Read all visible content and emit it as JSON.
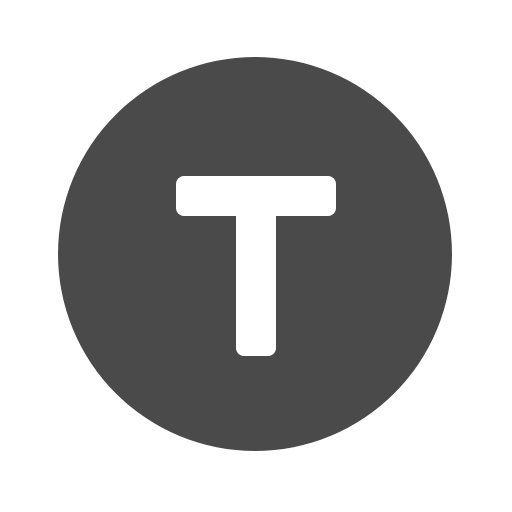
{
  "icon": {
    "name": "letter-t-circle-icon",
    "glyph": "T",
    "colors": {
      "circle": "#4a4a4a",
      "glyph": "#ffffff",
      "background": "#ffffff"
    }
  }
}
